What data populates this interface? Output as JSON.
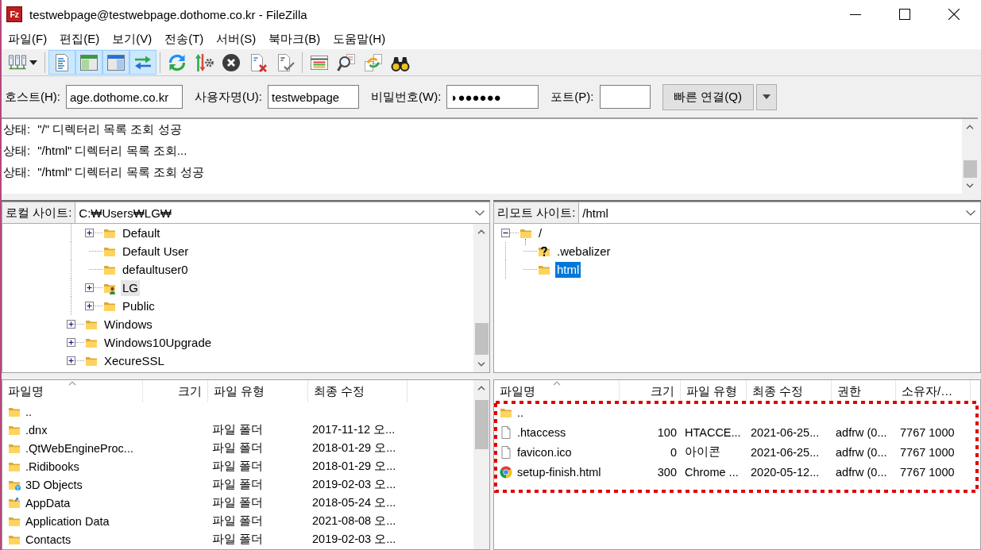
{
  "window": {
    "logo": "Fz",
    "title": "testwebpage@testwebpage.dothome.co.kr - FileZilla"
  },
  "menu": [
    "파일(F)",
    "편집(E)",
    "보기(V)",
    "전송(T)",
    "서버(S)",
    "북마크(B)",
    "도움말(H)"
  ],
  "toolbar": [
    [
      {
        "pressed": false
      }
    ],
    [
      {
        "pressed": true
      },
      {
        "pressed": true
      },
      {
        "pressed": true
      },
      {
        "pressed": true
      }
    ],
    [
      {
        "pressed": false
      },
      {
        "pressed": false
      },
      {
        "pressed": false
      },
      {
        "pressed": false
      },
      {
        "pressed": false
      }
    ],
    [
      {
        "pressed": false
      },
      {
        "pressed": false
      },
      {
        "pressed": false
      },
      {
        "pressed": false
      }
    ]
  ],
  "quickconnect": {
    "fields": [
      {
        "label": "호스트(H):",
        "value": "age.dothome.co.kr"
      },
      {
        "label": "사용자명(U):",
        "value": "testwebpage"
      },
      {
        "label": "비밀번호(W):",
        "value": "◗●●●●●●"
      },
      {
        "label": "포트(P):"
      }
    ],
    "button": "빠른 연결(Q)"
  },
  "log": [
    {
      "label": "상태:",
      "message": "\"/\" 디렉터리 목록 조회 성공"
    },
    {
      "label": "상태:",
      "message": "\"/html\" 디렉터리 목록 조회..."
    },
    {
      "label": "상태:",
      "message": "\"/html\" 디렉터리 목록 조회 성공"
    }
  ],
  "local": {
    "site_label": "로컬 사이트:",
    "path": "C:₩Users₩LG₩",
    "tree": {
      "focused": false,
      "items": [
        {
          "children": [
            {
              "label": "Default",
              "kind": "folder",
              "expandable": true,
              "expanded": false,
              "selected": false
            },
            {
              "label": "Default User",
              "kind": "folder",
              "expandable": false,
              "selected": false
            },
            {
              "label": "defaultuser0",
              "kind": "folder",
              "expandable": false,
              "selected": false
            },
            {
              "label": "LG",
              "kind": "user-folder",
              "expandable": true,
              "expanded": false,
              "selected": true
            },
            {
              "label": "Public",
              "kind": "folder",
              "expandable": true,
              "expanded": false,
              "selected": false
            }
          ]
        },
        {
          "label": "Windows",
          "kind": "folder",
          "expandable": true,
          "expanded": false,
          "selected": false
        },
        {
          "label": "Windows10Upgrade",
          "kind": "folder",
          "expandable": true,
          "expanded": false,
          "selected": false
        },
        {
          "label": "XecureSSL",
          "kind": "folder",
          "expandable": true,
          "expanded": false,
          "selected": false
        }
      ]
    },
    "files": {
      "columns": [
        {
          "label": "파일명",
          "sorted": true
        },
        {
          "label": "크기",
          "sorted": false
        },
        {
          "label": "파일 유형",
          "sorted": false
        },
        {
          "label": "최종 수정",
          "sorted": false
        }
      ],
      "rows": [
        {
          "kind": "folder",
          "name": ".."
        },
        {
          "kind": "folder",
          "name": ".dnx",
          "type": "파일 폴더",
          "modified": "2017-11-12 오..."
        },
        {
          "kind": "folder",
          "name": ".QtWebEngineProc...",
          "type": "파일 폴더",
          "modified": "2018-01-29 오..."
        },
        {
          "kind": "folder",
          "name": ".Ridibooks",
          "type": "파일 폴더",
          "modified": "2018-01-29 오..."
        },
        {
          "kind": "cube-folder",
          "name": "3D Objects",
          "type": "파일 폴더",
          "modified": "2019-02-03 오..."
        },
        {
          "kind": "arrow-folder",
          "name": "AppData",
          "type": "파일 폴더",
          "modified": "2018-05-24 오..."
        },
        {
          "kind": "folder",
          "name": "Application Data",
          "type": "파일 폴더",
          "modified": "2021-08-08 오..."
        },
        {
          "kind": "folder",
          "name": "Contacts",
          "type": "파일 폴더",
          "modified": "2019-02-03 오..."
        }
      ]
    }
  },
  "remote": {
    "site_label": "리모트 사이트:",
    "path": "/html",
    "tree": {
      "focused": true,
      "items": [
        {
          "label": "/",
          "kind": "folder",
          "expandable": true,
          "expanded": true,
          "selected": false,
          "children": [
            {
              "label": ".webalizer",
              "kind": "unknown",
              "expandable": false,
              "selected": false
            },
            {
              "label": "html",
              "kind": "folder",
              "expandable": false,
              "selected": true
            }
          ]
        }
      ]
    },
    "files": {
      "highlighted": true,
      "columns": [
        {
          "label": "파일명",
          "sorted": true
        },
        {
          "label": "크기",
          "sorted": false
        },
        {
          "label": "파일 유형",
          "sorted": false
        },
        {
          "label": "최종 수정",
          "sorted": false
        },
        {
          "label": "권한",
          "sorted": false
        },
        {
          "label": "소유자/…",
          "sorted": false
        }
      ],
      "rows": [
        {
          "kind": "folder",
          "name": ".."
        },
        {
          "kind": "document",
          "name": ".htaccess",
          "size": "100",
          "type": "HTACCE...",
          "modified": "2021-06-25...",
          "permissions": "adfrw (0...",
          "owner": "7767 1000"
        },
        {
          "kind": "document",
          "name": "favicon.ico",
          "size": "0",
          "type": "아이콘",
          "modified": "2021-06-25...",
          "permissions": "adfrw (0...",
          "owner": "7767 1000"
        },
        {
          "kind": "browser",
          "name": "setup-finish.html",
          "size": "300",
          "type": "Chrome ...",
          "modified": "2020-05-12...",
          "permissions": "adfrw (0...",
          "owner": "7767 1000"
        }
      ]
    }
  }
}
